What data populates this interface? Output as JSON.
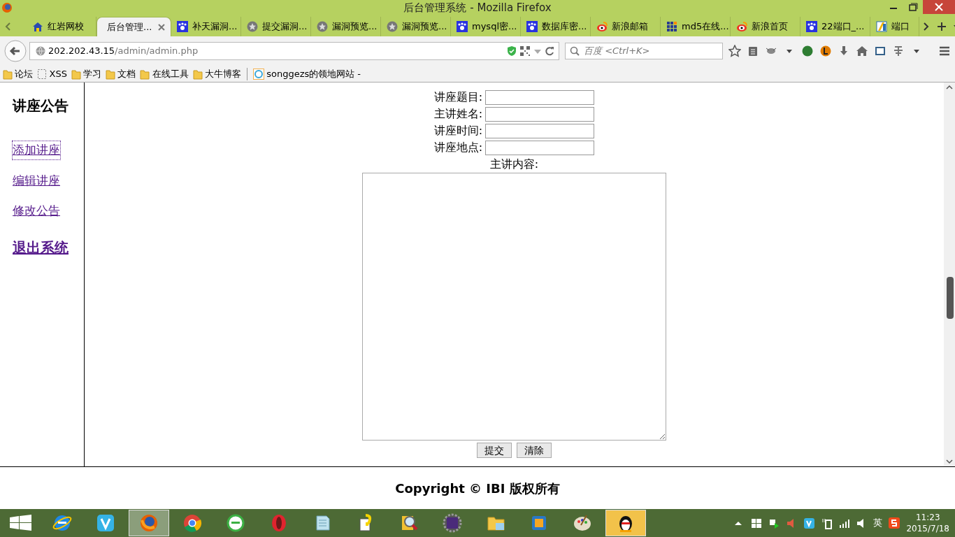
{
  "window": {
    "title": "后台管理系统 - Mozilla Firefox"
  },
  "tabs": [
    {
      "label": "红岩网校",
      "selected": false,
      "kind": "house"
    },
    {
      "label": "后台管理...",
      "selected": true,
      "kind": "none"
    },
    {
      "label": "补天漏洞...",
      "selected": false,
      "kind": "paw"
    },
    {
      "label": "提交漏洞...",
      "selected": false,
      "kind": "star"
    },
    {
      "label": "漏洞预览...",
      "selected": false,
      "kind": "star"
    },
    {
      "label": "漏洞预览...",
      "selected": false,
      "kind": "star"
    },
    {
      "label": "mysql密...",
      "selected": false,
      "kind": "paw"
    },
    {
      "label": "数据库密...",
      "selected": false,
      "kind": "paw"
    },
    {
      "label": "新浪邮箱",
      "selected": false,
      "kind": "eye"
    },
    {
      "label": "md5在线...",
      "selected": false,
      "kind": "grid"
    },
    {
      "label": "新浪首页",
      "selected": false,
      "kind": "eye"
    },
    {
      "label": "22端口_...",
      "selected": false,
      "kind": "paw"
    },
    {
      "label": "端口",
      "selected": false,
      "kind": "bar"
    }
  ],
  "address": {
    "host": "202.202.43.15",
    "path": "/admin/admin.php"
  },
  "search": {
    "placeholder": "百度 <Ctrl+K>"
  },
  "bookmarks": [
    {
      "label": "论坛",
      "kind": "folder"
    },
    {
      "label": "XSS",
      "kind": "dashed"
    },
    {
      "label": "学习",
      "kind": "folder"
    },
    {
      "label": "文档",
      "kind": "folder"
    },
    {
      "label": "在线工具",
      "kind": "folder"
    },
    {
      "label": "大牛博客",
      "kind": "folder"
    },
    {
      "label": "songgezs的领地网站 -",
      "kind": "site"
    }
  ],
  "sidebar": {
    "heading": "讲座公告",
    "links": [
      {
        "label": "添加讲座",
        "kind": "link",
        "focused": true
      },
      {
        "label": "编辑讲座",
        "kind": "link",
        "focused": false
      },
      {
        "label": "修改公告",
        "kind": "link",
        "focused": false
      },
      {
        "label": "退出系统",
        "kind": "strong",
        "focused": false
      }
    ]
  },
  "form": {
    "fields": [
      {
        "label": "讲座题目:"
      },
      {
        "label": "主讲姓名:"
      },
      {
        "label": "讲座时间:"
      },
      {
        "label": "讲座地点:"
      }
    ],
    "content_label": "主讲内容:",
    "buttons": [
      "提交",
      "清除"
    ]
  },
  "footer": "Copyright © IBI 版权所有",
  "taskbar": {
    "apps": [
      {
        "kind": "ie",
        "selected": false
      },
      {
        "kind": "v",
        "selected": false
      },
      {
        "kind": "firefox",
        "selected": true
      },
      {
        "kind": "chrome",
        "selected": false
      },
      {
        "kind": "greene",
        "selected": false
      },
      {
        "kind": "opera",
        "selected": false
      },
      {
        "kind": "notepad",
        "selected": false
      },
      {
        "kind": "help",
        "selected": false
      },
      {
        "kind": "search",
        "selected": false
      },
      {
        "kind": "gear",
        "selected": false
      },
      {
        "kind": "folder",
        "selected": false
      },
      {
        "kind": "window",
        "selected": false
      },
      {
        "kind": "palette",
        "selected": false
      },
      {
        "kind": "penguin",
        "selected": true
      }
    ],
    "ime": "英",
    "time": "11:23",
    "date": "2015/7/18"
  }
}
